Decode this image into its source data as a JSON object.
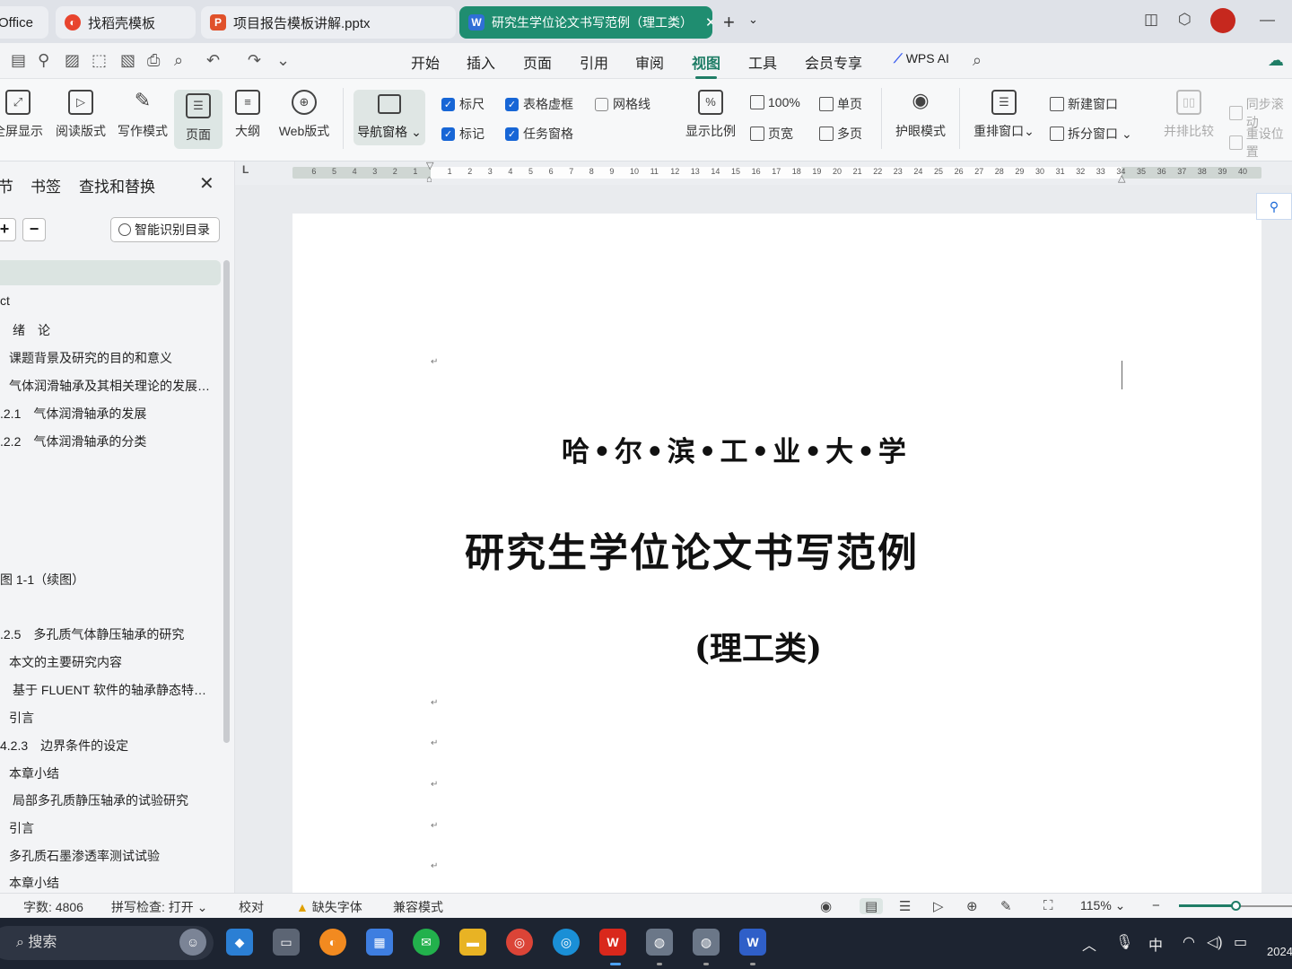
{
  "tabs": [
    {
      "label": "Office",
      "icon": "",
      "color": ""
    },
    {
      "label": "找稻壳模板",
      "icon": "daoke-icon",
      "color": "#e8442e"
    },
    {
      "label": "项目报告模板讲解.pptx",
      "icon": "P",
      "color": "#e0512a"
    },
    {
      "label": "研究生学位论文书写范例（理工类）",
      "icon": "W",
      "color": "#2f6fd6"
    }
  ],
  "menu": [
    "开始",
    "插入",
    "页面",
    "引用",
    "审阅",
    "视图",
    "工具",
    "会员专享",
    "WPS AI"
  ],
  "ribbon": {
    "fullscreen": "全屏显示",
    "reading": "阅读版式",
    "writing": "写作模式",
    "page": "页面",
    "outline": "大纲",
    "web": "Web版式",
    "nav": "导航窗格",
    "ruler": "标尺",
    "marks": "标记",
    "table_grid": "表格虚框",
    "task_pane": "任务窗格",
    "gridlines": "网格线",
    "zoom_ratio": "显示比例",
    "zoom100": "100%",
    "page_width": "页宽",
    "single_page": "单页",
    "multi_page": "多页",
    "eye_care": "护眼模式",
    "rearrange": "重排窗口",
    "new_window": "新建窗口",
    "split_window": "拆分窗口",
    "side_by_side": "并排比较",
    "sync_scroll": "同步滚动",
    "reset_position": "重设位置"
  },
  "sidebar": {
    "tabs": [
      "节",
      "书签",
      "查找和替换"
    ],
    "smart_toc": "智能识别目录",
    "items": [
      "ct",
      "绪　论",
      "课题背景及研究的目的和意义",
      "气体润滑轴承及其相关理论的发展…",
      ".2.1　气体润滑轴承的发展",
      ".2.2　气体润滑轴承的分类",
      "图 1-1（续图）",
      ".2.5　多孔质气体静压轴承的研究",
      "本文的主要研究内容",
      "基于 FLUENT 软件的轴承静态特…",
      "引言",
      "4.2.3　边界条件的设定",
      "本章小结",
      "局部多孔质静压轴承的试验研究",
      "引言",
      "多孔质石墨渗透率测试试验",
      "本章小结"
    ]
  },
  "ruler": {
    "left": [
      "6",
      "5",
      "4",
      "3",
      "2",
      "1"
    ],
    "right": [
      "1",
      "2",
      "3",
      "4",
      "5",
      "6",
      "7",
      "8",
      "9",
      "10",
      "11",
      "12",
      "13",
      "14",
      "15",
      "16",
      "17",
      "18",
      "19",
      "20",
      "21",
      "22",
      "23",
      "24",
      "25",
      "26",
      "27",
      "28",
      "29",
      "30",
      "31",
      "32",
      "33",
      "34",
      "35",
      "36",
      "37",
      "38",
      "39",
      "40"
    ]
  },
  "document": {
    "university": "哈•尔•滨•工•业•大•学",
    "title": "研究生学位论文书写范例",
    "subtitle": "(理工类)"
  },
  "status": {
    "word_count": "字数: 4806",
    "spell_check": "拼写检查: 打开",
    "proofread": "校对",
    "missing_font": "缺失字体",
    "compat_mode": "兼容模式",
    "zoom": "115%",
    "zoom_fraction": 0.5
  },
  "taskbar": {
    "search": "搜索",
    "ime": "中",
    "year": "2024"
  },
  "colors": {
    "accent": "#1f7d66",
    "active_tab": "#1f8d70",
    "checkbox": "#1766d6",
    "taskbar": "#1d2431"
  }
}
